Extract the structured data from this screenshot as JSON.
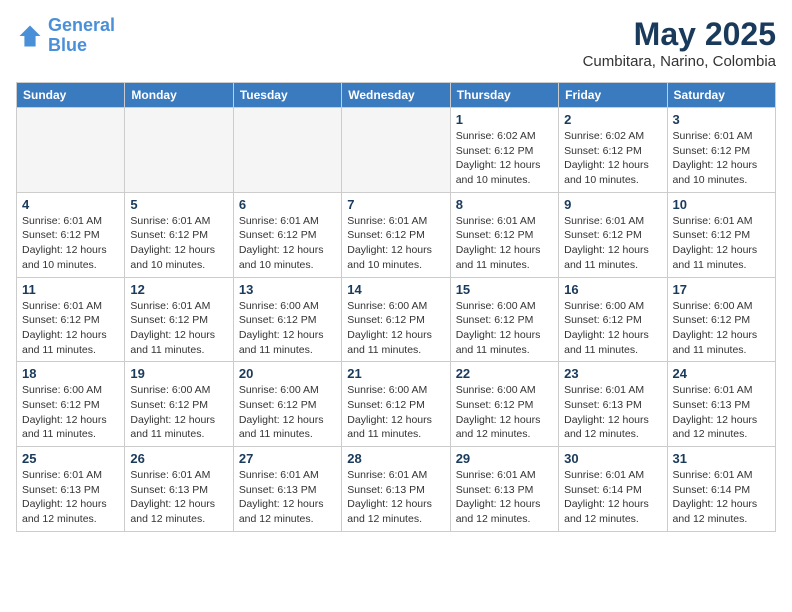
{
  "logo": {
    "line1": "General",
    "line2": "Blue"
  },
  "title": "May 2025",
  "location": "Cumbitara, Narino, Colombia",
  "days_of_week": [
    "Sunday",
    "Monday",
    "Tuesday",
    "Wednesday",
    "Thursday",
    "Friday",
    "Saturday"
  ],
  "weeks": [
    [
      {
        "day": "",
        "info": ""
      },
      {
        "day": "",
        "info": ""
      },
      {
        "day": "",
        "info": ""
      },
      {
        "day": "",
        "info": ""
      },
      {
        "day": "1",
        "info": "Sunrise: 6:02 AM\nSunset: 6:12 PM\nDaylight: 12 hours\nand 10 minutes."
      },
      {
        "day": "2",
        "info": "Sunrise: 6:02 AM\nSunset: 6:12 PM\nDaylight: 12 hours\nand 10 minutes."
      },
      {
        "day": "3",
        "info": "Sunrise: 6:01 AM\nSunset: 6:12 PM\nDaylight: 12 hours\nand 10 minutes."
      }
    ],
    [
      {
        "day": "4",
        "info": "Sunrise: 6:01 AM\nSunset: 6:12 PM\nDaylight: 12 hours\nand 10 minutes."
      },
      {
        "day": "5",
        "info": "Sunrise: 6:01 AM\nSunset: 6:12 PM\nDaylight: 12 hours\nand 10 minutes."
      },
      {
        "day": "6",
        "info": "Sunrise: 6:01 AM\nSunset: 6:12 PM\nDaylight: 12 hours\nand 10 minutes."
      },
      {
        "day": "7",
        "info": "Sunrise: 6:01 AM\nSunset: 6:12 PM\nDaylight: 12 hours\nand 10 minutes."
      },
      {
        "day": "8",
        "info": "Sunrise: 6:01 AM\nSunset: 6:12 PM\nDaylight: 12 hours\nand 11 minutes."
      },
      {
        "day": "9",
        "info": "Sunrise: 6:01 AM\nSunset: 6:12 PM\nDaylight: 12 hours\nand 11 minutes."
      },
      {
        "day": "10",
        "info": "Sunrise: 6:01 AM\nSunset: 6:12 PM\nDaylight: 12 hours\nand 11 minutes."
      }
    ],
    [
      {
        "day": "11",
        "info": "Sunrise: 6:01 AM\nSunset: 6:12 PM\nDaylight: 12 hours\nand 11 minutes."
      },
      {
        "day": "12",
        "info": "Sunrise: 6:01 AM\nSunset: 6:12 PM\nDaylight: 12 hours\nand 11 minutes."
      },
      {
        "day": "13",
        "info": "Sunrise: 6:00 AM\nSunset: 6:12 PM\nDaylight: 12 hours\nand 11 minutes."
      },
      {
        "day": "14",
        "info": "Sunrise: 6:00 AM\nSunset: 6:12 PM\nDaylight: 12 hours\nand 11 minutes."
      },
      {
        "day": "15",
        "info": "Sunrise: 6:00 AM\nSunset: 6:12 PM\nDaylight: 12 hours\nand 11 minutes."
      },
      {
        "day": "16",
        "info": "Sunrise: 6:00 AM\nSunset: 6:12 PM\nDaylight: 12 hours\nand 11 minutes."
      },
      {
        "day": "17",
        "info": "Sunrise: 6:00 AM\nSunset: 6:12 PM\nDaylight: 12 hours\nand 11 minutes."
      }
    ],
    [
      {
        "day": "18",
        "info": "Sunrise: 6:00 AM\nSunset: 6:12 PM\nDaylight: 12 hours\nand 11 minutes."
      },
      {
        "day": "19",
        "info": "Sunrise: 6:00 AM\nSunset: 6:12 PM\nDaylight: 12 hours\nand 11 minutes."
      },
      {
        "day": "20",
        "info": "Sunrise: 6:00 AM\nSunset: 6:12 PM\nDaylight: 12 hours\nand 11 minutes."
      },
      {
        "day": "21",
        "info": "Sunrise: 6:00 AM\nSunset: 6:12 PM\nDaylight: 12 hours\nand 11 minutes."
      },
      {
        "day": "22",
        "info": "Sunrise: 6:00 AM\nSunset: 6:12 PM\nDaylight: 12 hours\nand 12 minutes."
      },
      {
        "day": "23",
        "info": "Sunrise: 6:01 AM\nSunset: 6:13 PM\nDaylight: 12 hours\nand 12 minutes."
      },
      {
        "day": "24",
        "info": "Sunrise: 6:01 AM\nSunset: 6:13 PM\nDaylight: 12 hours\nand 12 minutes."
      }
    ],
    [
      {
        "day": "25",
        "info": "Sunrise: 6:01 AM\nSunset: 6:13 PM\nDaylight: 12 hours\nand 12 minutes."
      },
      {
        "day": "26",
        "info": "Sunrise: 6:01 AM\nSunset: 6:13 PM\nDaylight: 12 hours\nand 12 minutes."
      },
      {
        "day": "27",
        "info": "Sunrise: 6:01 AM\nSunset: 6:13 PM\nDaylight: 12 hours\nand 12 minutes."
      },
      {
        "day": "28",
        "info": "Sunrise: 6:01 AM\nSunset: 6:13 PM\nDaylight: 12 hours\nand 12 minutes."
      },
      {
        "day": "29",
        "info": "Sunrise: 6:01 AM\nSunset: 6:13 PM\nDaylight: 12 hours\nand 12 minutes."
      },
      {
        "day": "30",
        "info": "Sunrise: 6:01 AM\nSunset: 6:14 PM\nDaylight: 12 hours\nand 12 minutes."
      },
      {
        "day": "31",
        "info": "Sunrise: 6:01 AM\nSunset: 6:14 PM\nDaylight: 12 hours\nand 12 minutes."
      }
    ]
  ]
}
